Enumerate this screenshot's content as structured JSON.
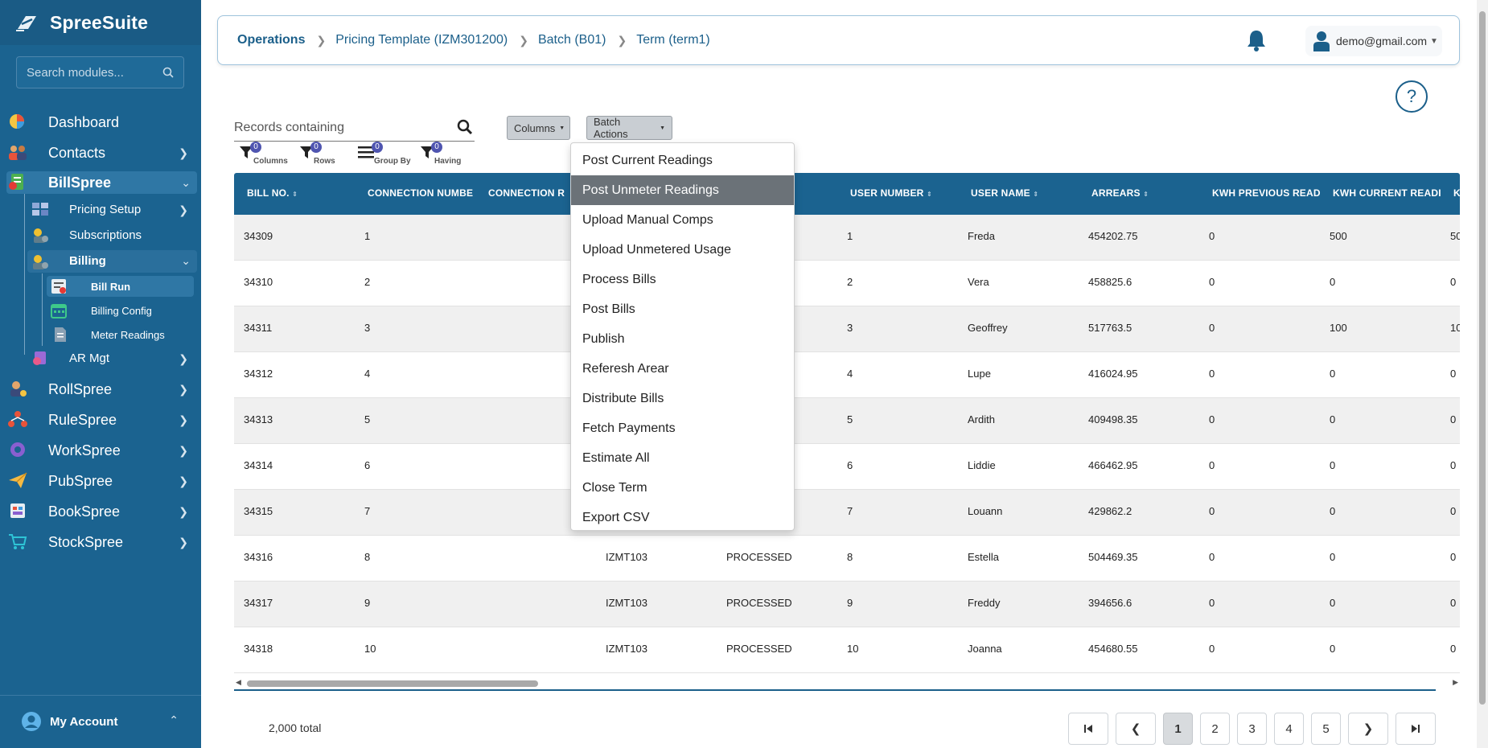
{
  "brand": {
    "name": "SpreeSuite"
  },
  "sidebar": {
    "search_placeholder": "Search modules...",
    "items": [
      {
        "label": "Dashboard"
      },
      {
        "label": "Contacts"
      },
      {
        "label": "BillSpree"
      },
      {
        "label": "Pricing Setup"
      },
      {
        "label": "Subscriptions"
      },
      {
        "label": "Billing"
      },
      {
        "label": "Bill Run"
      },
      {
        "label": "Billing Config"
      },
      {
        "label": "Meter Readings"
      },
      {
        "label": "AR Mgt"
      },
      {
        "label": "RollSpree"
      },
      {
        "label": "RuleSpree"
      },
      {
        "label": "WorkSpree"
      },
      {
        "label": "PubSpree"
      },
      {
        "label": "BookSpree"
      },
      {
        "label": "StockSpree"
      }
    ],
    "account_label": "My Account"
  },
  "header": {
    "breadcrumbs": [
      "Operations",
      "Pricing Template (IZM301200)",
      "Batch (B01)",
      "Term (term1)"
    ],
    "user_email": "demo@gmail.com"
  },
  "toolbar": {
    "records_placeholder": "Records containing",
    "columns_button": "Columns",
    "batch_actions_button": "Batch Actions",
    "filters": [
      {
        "count": "0",
        "label": "Columns"
      },
      {
        "count": "0",
        "label": "Rows"
      },
      {
        "count": "0",
        "label": "Group By"
      },
      {
        "count": "0",
        "label": "Having"
      }
    ]
  },
  "table": {
    "headers": [
      "BILL NO.",
      "CONNECTION NUMBE",
      "CONNECTION R",
      "",
      "",
      "USER NUMBER",
      "USER NAME",
      "ARREARS",
      "KWH PREVIOUS READ",
      "KWH CURRENT READI",
      "K"
    ],
    "rows": [
      [
        "34309",
        "1",
        "",
        "",
        "",
        "1",
        "Freda",
        "454202.75",
        "0",
        "500",
        "50"
      ],
      [
        "34310",
        "2",
        "",
        "",
        "",
        "2",
        "Vera",
        "458825.6",
        "0",
        "0",
        "0"
      ],
      [
        "34311",
        "3",
        "",
        "",
        "",
        "3",
        "Geoffrey",
        "517763.5",
        "0",
        "100",
        "10"
      ],
      [
        "34312",
        "4",
        "",
        "",
        "",
        "4",
        "Lupe",
        "416024.95",
        "0",
        "0",
        "0"
      ],
      [
        "34313",
        "5",
        "",
        "",
        "",
        "5",
        "Ardith",
        "409498.35",
        "0",
        "0",
        "0"
      ],
      [
        "34314",
        "6",
        "",
        "",
        "",
        "6",
        "Liddie",
        "466462.95",
        "0",
        "0",
        "0"
      ],
      [
        "34315",
        "7",
        "",
        "",
        "",
        "7",
        "Louann",
        "429862.2",
        "0",
        "0",
        "0"
      ],
      [
        "34316",
        "8",
        "",
        "IZMT103",
        "PROCESSED",
        "8",
        "Estella",
        "504469.35",
        "0",
        "0",
        "0"
      ],
      [
        "34317",
        "9",
        "",
        "IZMT103",
        "PROCESSED",
        "9",
        "Freddy",
        "394656.6",
        "0",
        "0",
        "0"
      ],
      [
        "34318",
        "10",
        "",
        "IZMT103",
        "PROCESSED",
        "10",
        "Joanna",
        "454680.55",
        "0",
        "0",
        "0"
      ]
    ]
  },
  "batch_actions_menu": {
    "items": [
      "Post Current Readings",
      "Post Unmeter Readings",
      "Upload Manual Comps",
      "Upload Unmetered Usage",
      "Process Bills",
      "Post Bills",
      "Publish",
      "Referesh Arear",
      "Distribute Bills",
      "Fetch Payments",
      "Estimate All",
      "Close Term",
      "Export CSV"
    ],
    "highlighted": "Post Unmeter Readings"
  },
  "footer": {
    "total_text": "2,000 total",
    "pages": [
      "1",
      "2",
      "3",
      "4",
      "5"
    ],
    "current_page": "1"
  }
}
